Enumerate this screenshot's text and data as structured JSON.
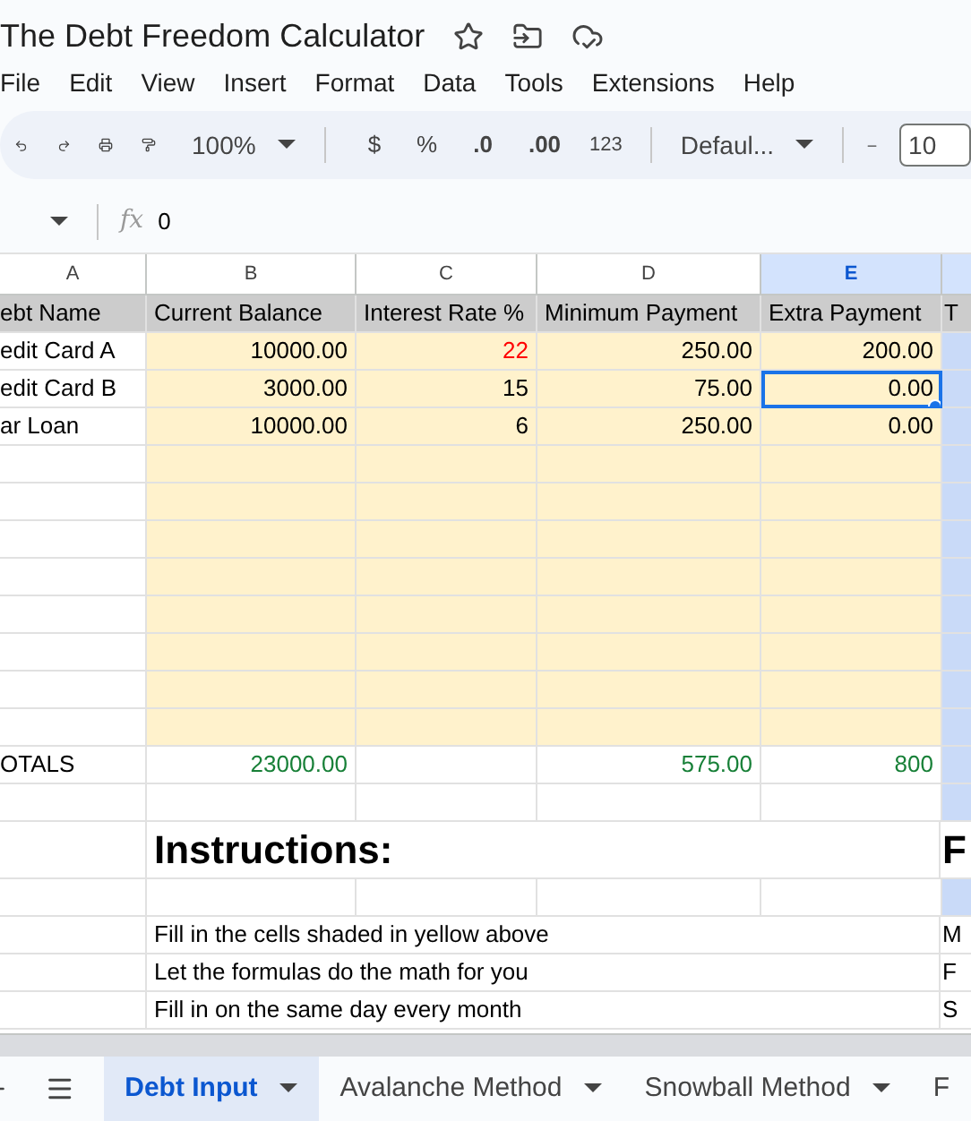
{
  "document": {
    "title": "The Debt Freedom Calculator"
  },
  "menu": [
    "File",
    "Edit",
    "View",
    "Insert",
    "Format",
    "Data",
    "Tools",
    "Extensions",
    "Help"
  ],
  "toolbar": {
    "zoom": "100%",
    "currency": "$",
    "percent": "%",
    "decrease_decimal": ".0",
    "increase_decimal": ".00",
    "number_format": "123",
    "font": "Defaul...",
    "font_size": "10"
  },
  "formula_bar": {
    "label": "fx",
    "value": "0"
  },
  "column_headers": [
    {
      "label": "A",
      "selected": false
    },
    {
      "label": "B",
      "selected": false
    },
    {
      "label": "C",
      "selected": false
    },
    {
      "label": "D",
      "selected": false
    },
    {
      "label": "E",
      "selected": true
    }
  ],
  "rows": [
    {
      "kind": "header",
      "cells": [
        "ebt Name",
        "Current Balance",
        "Interest Rate %",
        "Minimum Payment",
        "Extra Payment",
        "T"
      ]
    },
    {
      "kind": "data",
      "cells": [
        {
          "text": "edit Card A",
          "selected": false
        },
        {
          "text": "10000.00",
          "selected": false
        },
        {
          "text": "22",
          "selected": false,
          "color": "#ff0000"
        },
        {
          "text": "250.00",
          "selected": false
        },
        {
          "text": "200.00",
          "selected": false
        }
      ]
    },
    {
      "kind": "data",
      "cells": [
        {
          "text": "edit Card B",
          "selected": false
        },
        {
          "text": "3000.00",
          "selected": false
        },
        {
          "text": "15",
          "selected": false
        },
        {
          "text": "75.00",
          "selected": false
        },
        {
          "text": "0.00",
          "selected": true
        }
      ]
    },
    {
      "kind": "data",
      "cells": [
        {
          "text": "ar Loan",
          "selected": false
        },
        {
          "text": "10000.00",
          "selected": false
        },
        {
          "text": "6",
          "selected": false
        },
        {
          "text": "250.00",
          "selected": false
        },
        {
          "text": "0.00",
          "selected": false
        }
      ]
    },
    {
      "kind": "blank"
    },
    {
      "kind": "blank"
    },
    {
      "kind": "blank"
    },
    {
      "kind": "blank"
    },
    {
      "kind": "blank"
    },
    {
      "kind": "blank"
    },
    {
      "kind": "blank"
    },
    {
      "kind": "blank"
    },
    {
      "kind": "totals",
      "cells": [
        "OTALS",
        "23000.00",
        "",
        "575.00",
        "800"
      ]
    },
    {
      "kind": "empty"
    },
    {
      "kind": "heading",
      "text": "Instructions:",
      "column_6": "F"
    },
    {
      "kind": "empty"
    },
    {
      "kind": "text",
      "text": "Fill in the cells shaded in yellow above",
      "column_6": "M"
    },
    {
      "kind": "text",
      "text": "Let the formulas do the math for you",
      "column_6": "F"
    },
    {
      "kind": "text",
      "text": "Fill in on the same day every month",
      "column_6": "S"
    }
  ],
  "sheet_tabs": [
    {
      "label": "Debt Input",
      "selected": true
    },
    {
      "label": "Avalanche Method",
      "selected": false
    },
    {
      "label": "Snowball Method",
      "selected": false
    },
    {
      "label": "F",
      "selected": false
    }
  ]
}
